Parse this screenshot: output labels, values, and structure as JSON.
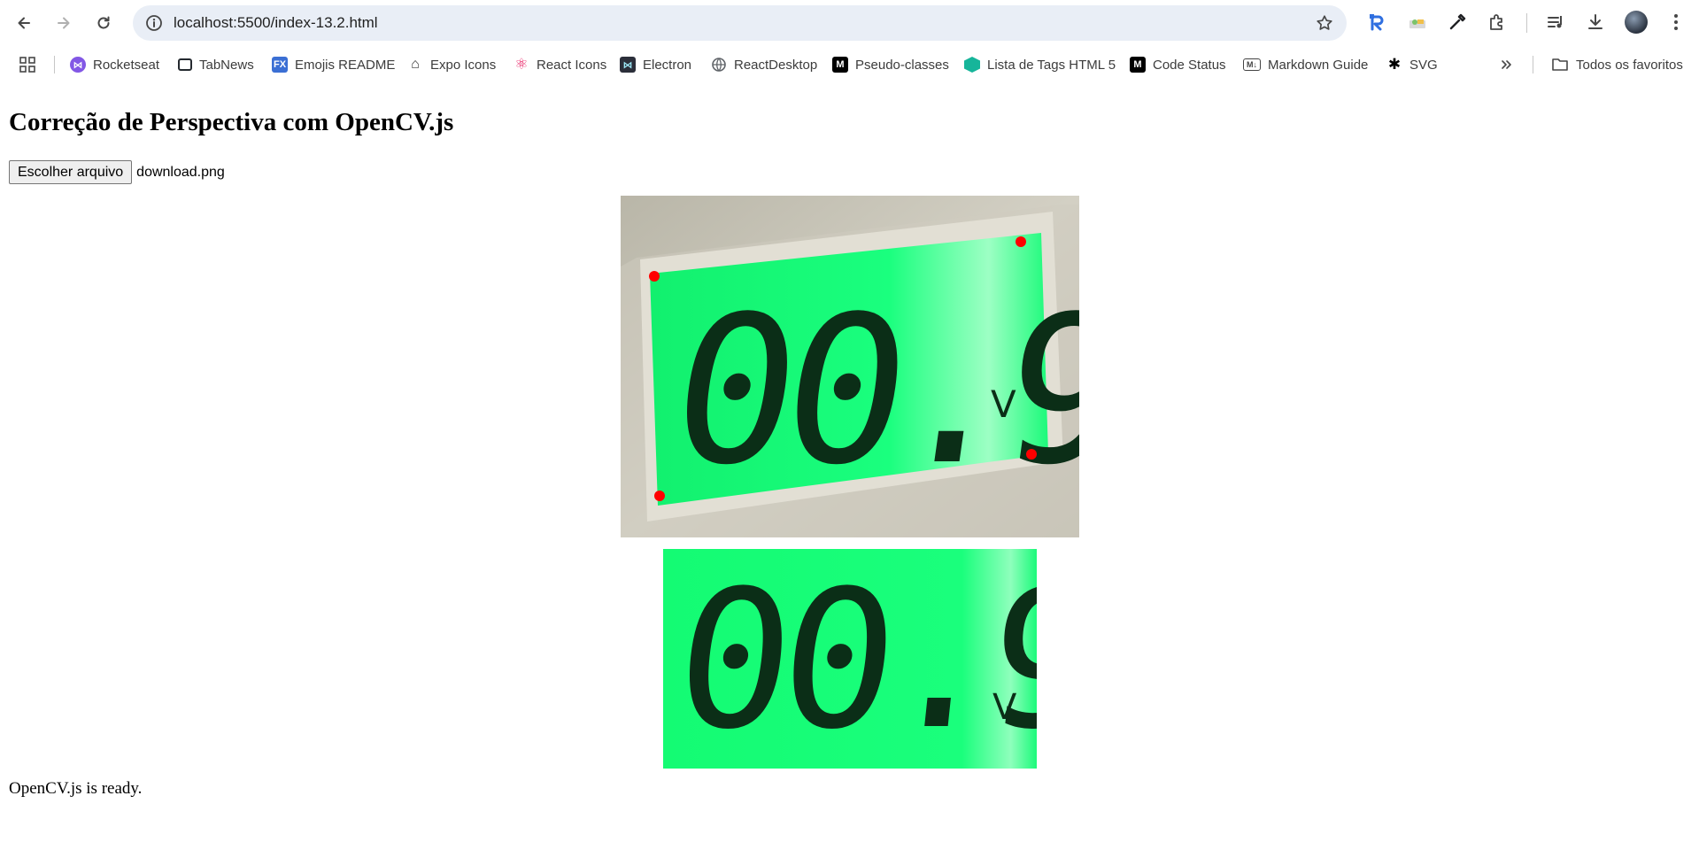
{
  "browser": {
    "url": "localhost:5500/index-13.2.html",
    "bookmarks": [
      {
        "label": "Rocketseat",
        "icon": "rocketseat-icon",
        "color": "#8257e5"
      },
      {
        "label": "TabNews",
        "icon": "tabnews-icon",
        "color": "#24292f"
      },
      {
        "label": "Emojis README",
        "icon": "fx-icon",
        "color": "#3b6fd4"
      },
      {
        "label": "Expo Icons",
        "icon": "expo-icon",
        "color": "#333333"
      },
      {
        "label": "React Icons",
        "icon": "react-icon",
        "color": "#e91e63"
      },
      {
        "label": "Electron",
        "icon": "electron-icon",
        "color": "#2b2e3a"
      },
      {
        "label": "ReactDesktop",
        "icon": "globe-icon",
        "color": "#5f6368"
      },
      {
        "label": "Pseudo-classes",
        "icon": "mdn-icon",
        "color": "#000000"
      },
      {
        "label": "Lista de Tags HTML 5",
        "icon": "hex-icon",
        "color": "#16b59a"
      },
      {
        "label": "Code Status",
        "icon": "mdn-icon",
        "color": "#000000"
      },
      {
        "label": "Markdown Guide",
        "icon": "markdown-icon",
        "color": "#444444"
      },
      {
        "label": "SVG",
        "icon": "svg-icon",
        "color": "#000000"
      }
    ],
    "all_bookmarks_label": "Todos os favoritos"
  },
  "page": {
    "title": "Correção de Perspectiva com OpenCV.js",
    "file_button": "Escolher arquivo",
    "file_name": "download.png",
    "status": "OpenCV.js is ready.",
    "lcd_reading": "00.9",
    "lcd_unit": "V"
  },
  "colors": {
    "lcd_green": "#14ff7a",
    "corner_marker": "#ff0000",
    "bezel": "#c9c6b9"
  }
}
